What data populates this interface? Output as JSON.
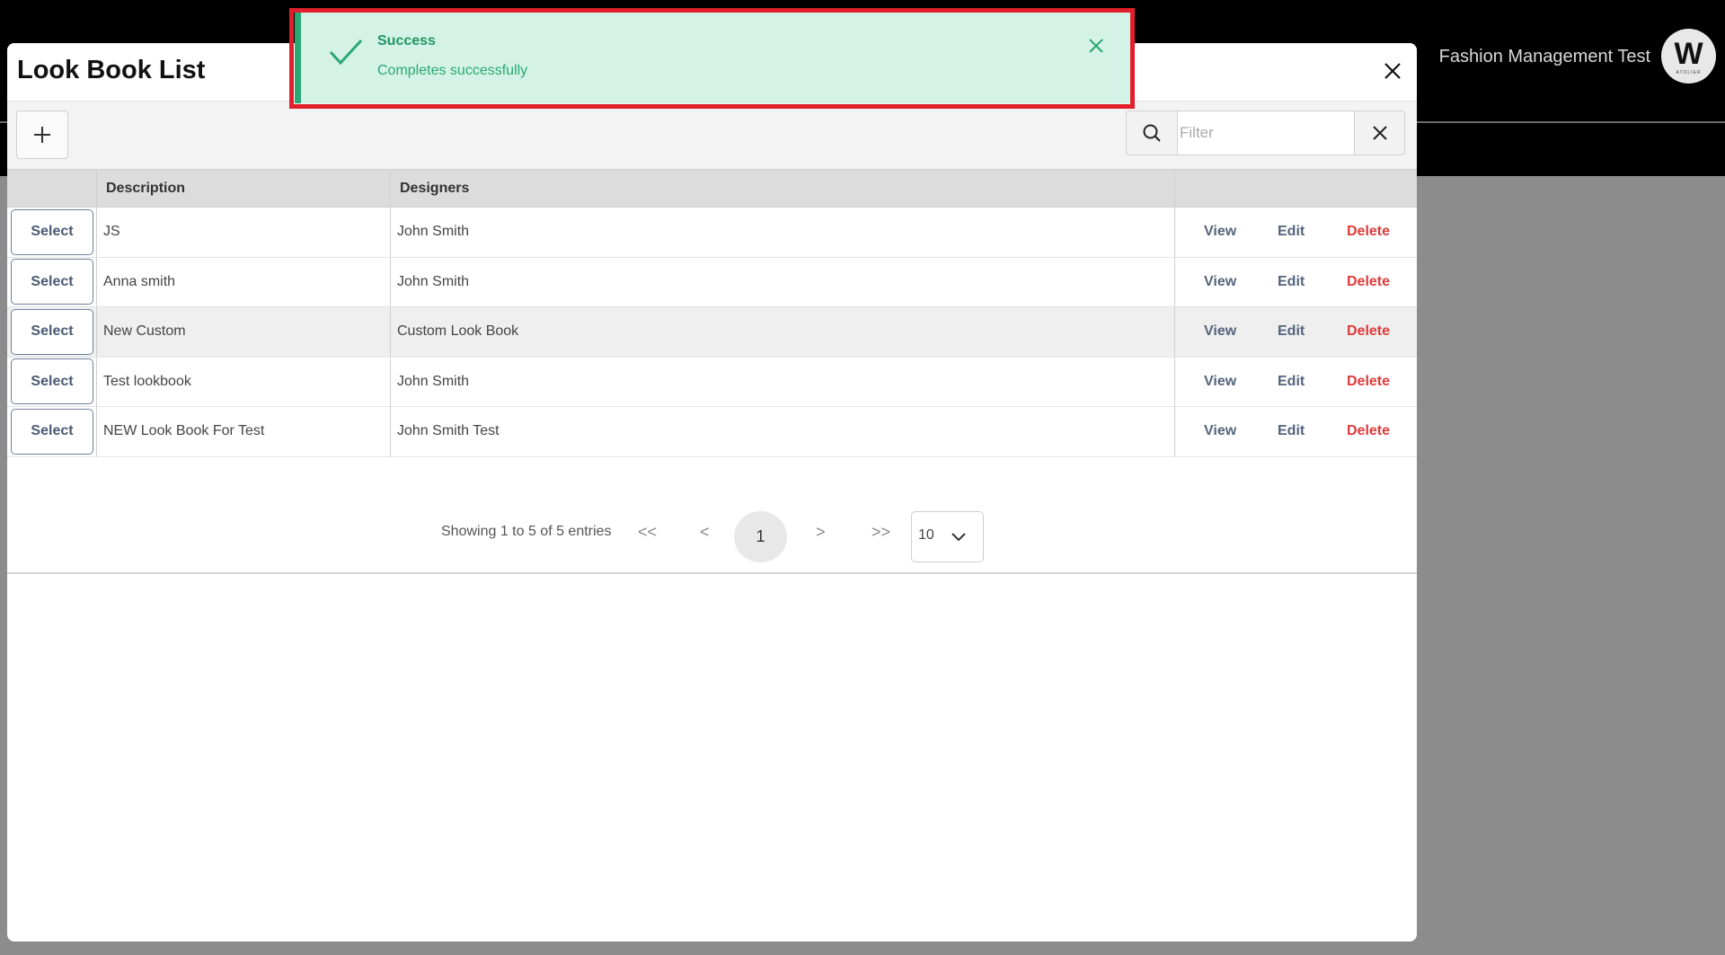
{
  "app": {
    "user_name": "Fashion Management Test",
    "avatar_letter": "W",
    "avatar_caption": "ATOLIER"
  },
  "modal": {
    "title": "Look Book List",
    "filter_placeholder": "Filter",
    "columns": [
      "Description",
      "Designers"
    ],
    "rows": [
      {
        "description": "JS",
        "designers": "John Smith"
      },
      {
        "description": "Anna smith",
        "designers": "John Smith"
      },
      {
        "description": "New Custom",
        "designers": "Custom Look Book"
      },
      {
        "description": "Test lookbook",
        "designers": "John Smith"
      },
      {
        "description": "NEW Look Book For Test",
        "designers": "John Smith Test"
      }
    ],
    "select_label": "Select",
    "view_label": "View",
    "edit_label": "Edit",
    "delete_label": "Delete",
    "pager": {
      "info": "Showing 1 to 5 of 5 entries",
      "first": "<<",
      "prev": "<",
      "next": ">",
      "last": ">>",
      "current_page": "1",
      "page_size": "10"
    }
  },
  "toast": {
    "title": "Success",
    "message": "Completes successfully"
  },
  "colors": {
    "accent_green": "#2aa774",
    "delete_red": "#e03a3a",
    "highlight_border": "#e01f2b"
  },
  "icons": [
    "close-icon",
    "plus-icon",
    "search-icon",
    "clear-icon",
    "chevron-down-icon",
    "check-icon"
  ]
}
